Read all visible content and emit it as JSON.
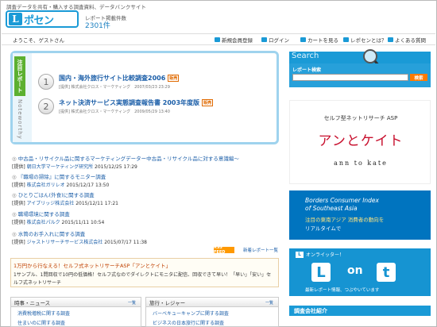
{
  "header": {
    "tagline": "調査データを共有・購入する調査資料、データバンクサイト",
    "logo_mark": "L",
    "logo_text": "ポセン",
    "count_label": "レポート掲載件数",
    "count_value": "2301件"
  },
  "nav": {
    "welcome": "ようこそ、ゲストさん",
    "items": [
      "新規会員登録",
      "ログイン",
      "カートを見る",
      "レポセンとは？",
      "よくある質問"
    ]
  },
  "noteworthy": {
    "tab_label": "注目レポート",
    "side_label": "Noteworthy",
    "items": [
      {
        "num": "1",
        "title": "国内・海外旅行サイト比較調査2006",
        "badge": "販売",
        "meta": "[提供] 株式会社クロス・マーケティング　2007/03/23 23:29"
      },
      {
        "num": "2",
        "title": "ネット決済サービス実態調査報告書 2003年度版",
        "badge": "販売",
        "meta": "[提供] 株式会社クロス・マーケティング　2009/05/29 13:40"
      }
    ]
  },
  "news": [
    {
      "title": "中古品・リサイクル品に関するマーケティングデーター中古品・リサイクル品に対する意識編～",
      "source": "朝日大学マーケティング研究所",
      "date": "2015/12/25 17:29"
    },
    {
      "title": "『職場の掃除』に関するモニター調査",
      "source": "株式会社ガリレオ",
      "date": "2015/12/17 13:50"
    },
    {
      "title": "ひとりごはん(外食)に関する調査",
      "source": "アイブリッジ株式会社",
      "date": "2015/12/11 17:21"
    },
    {
      "title": "職場環境に関する調査",
      "source": "株式会社パルク",
      "date": "2015/11/11 10:54"
    },
    {
      "title": "水筒のお手入れに関する調査",
      "source": "ジャストリサーチサービス株式会社",
      "date": "2015/07/17 11:38"
    }
  ],
  "news_source_prefix": "[提供] ",
  "rss_label": "RSS FEED",
  "news_list_link": "新着レポート一覧",
  "promo": {
    "title": "1万円から行なえる！セルフ式ネットリサーチASP「アンとケイト」",
    "text": "1サンプル、1問回収で10円の低価格！セルフ式なのでダイレクトにモニタに配信、回収できて早い！「早い」「安い」セルフ式ネットリサーチ"
  },
  "sections": [
    {
      "title": "時事・ニュース",
      "more": "一覧",
      "items": [
        "消費税増税に関する調査",
        "住まいのに関する調査"
      ]
    },
    {
      "title": "旅行・レジャー",
      "more": "一覧",
      "items": [
        "バーベキューキャンプに関する調査",
        "ビジネスの日本旅行に関する調査"
      ]
    }
  ],
  "search": {
    "heading": "Search",
    "label": "レポート検索",
    "input_value": "",
    "button": "検索"
  },
  "ads": {
    "ad1_top": "セルフ型ネットリサーチ ASP",
    "ad1_main": "アンとケイト",
    "ad1_sub": "ann to kate",
    "ad2_t1": "Borders Consumer Index",
    "ad2_t2": "of Southeast Asia",
    "ad2_t3": "注目の東南アジア 消費者の動向を",
    "ad2_t4": "リアルタイムで",
    "ad3_head": "オンライッター！",
    "ad3_logo": "L",
    "ad3_on": "on",
    "ad3_t": "t",
    "ad3_foot": "最新レポート情報、つぶやいています"
  },
  "company_section": "調査会社紹介"
}
